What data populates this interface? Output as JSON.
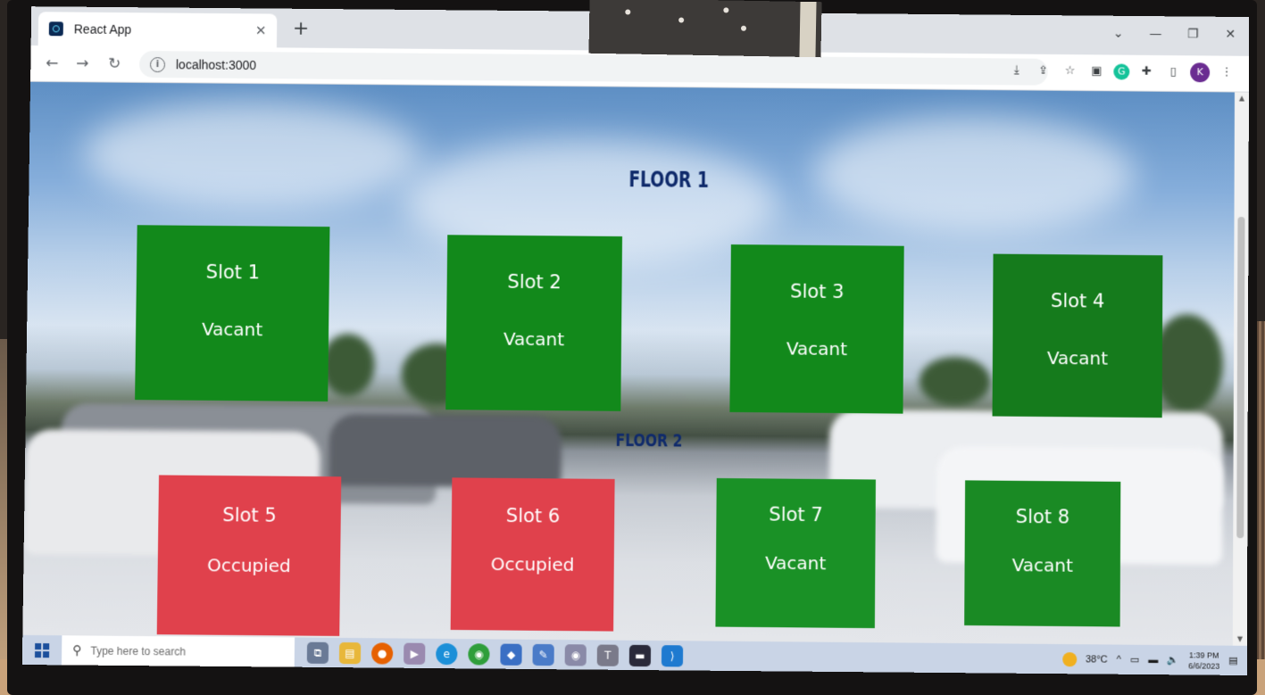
{
  "browser": {
    "tab_title": "React App",
    "tab_close": "✕",
    "new_tab": "+",
    "url": "localhost:3000",
    "nav": {
      "back": "←",
      "forward": "→",
      "reload": "↻"
    },
    "window_controls": {
      "dropdown": "⌄",
      "minimize": "—",
      "restore": "❐",
      "close": "✕"
    },
    "profile_initial": "K"
  },
  "page": {
    "floors": [
      {
        "title": "FLOOR 1",
        "slots": [
          {
            "label": "Slot 1",
            "status": "Vacant"
          },
          {
            "label": "Slot 2",
            "status": "Vacant"
          },
          {
            "label": "Slot 3",
            "status": "Vacant"
          },
          {
            "label": "Slot 4",
            "status": "Vacant"
          }
        ]
      },
      {
        "title": "FLOOR 2",
        "slots": [
          {
            "label": "Slot 5",
            "status": "Occupied"
          },
          {
            "label": "Slot 6",
            "status": "Occupied"
          },
          {
            "label": "Slot 7",
            "status": "Vacant"
          },
          {
            "label": "Slot 8",
            "status": "Vacant"
          }
        ]
      }
    ],
    "colors": {
      "vacant": "#12891b",
      "occupied": "#e0414c",
      "floor_title": "#0f2a6b"
    }
  },
  "taskbar": {
    "search_placeholder": "Type here to search",
    "weather": "38°C",
    "time": "1:39 PM",
    "date": "6/6/2023"
  }
}
